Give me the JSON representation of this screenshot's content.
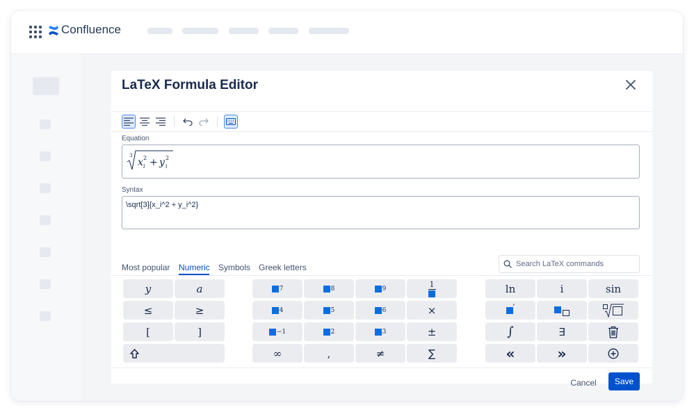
{
  "app": {
    "name": "Confluence",
    "accent": "#0052cc",
    "brand": "#2684ff"
  },
  "topbar": {
    "apps_icon": "grid-icon",
    "logo_icon": "confluence-icon"
  },
  "dialog": {
    "title": "LaTeX Formula Editor",
    "toolbar": [
      "align-left-icon",
      "align-center-icon",
      "align-right-icon",
      "undo-icon",
      "redo-icon",
      "keyboard-icon"
    ],
    "equation_label": "Equation",
    "syntax_label": "Syntax",
    "syntax_value": "\\sqrt[3]{x_i^2 + y_i^2}",
    "tabs": [
      "Most popular",
      "Numeric",
      "Symbols",
      "Greek letters"
    ],
    "active_tab": "Numeric",
    "search_placeholder": "Search LaTeX commands",
    "keys": {
      "y": "y",
      "a": "a",
      "le": "≤",
      "ge": "≥",
      "lbr": "[",
      "rbr": "]",
      "p7": "7",
      "p8": "8",
      "p9": "9",
      "p4": "4",
      "p5": "5",
      "p6": "6",
      "pm1": "−1",
      "p2": "2",
      "p3": "3",
      "times": "×",
      "plusminus": "±",
      "infinity": "∞",
      "comma": ",",
      "neq": "≠",
      "sum": "∑",
      "ln": "ln",
      "i": "i",
      "sin": "sin",
      "prime": "′",
      "integral": "∫",
      "exists": "∃",
      "left": "«",
      "right": "»",
      "frac_one": "1"
    },
    "cancel_label": "Cancel",
    "save_label": "Save"
  }
}
